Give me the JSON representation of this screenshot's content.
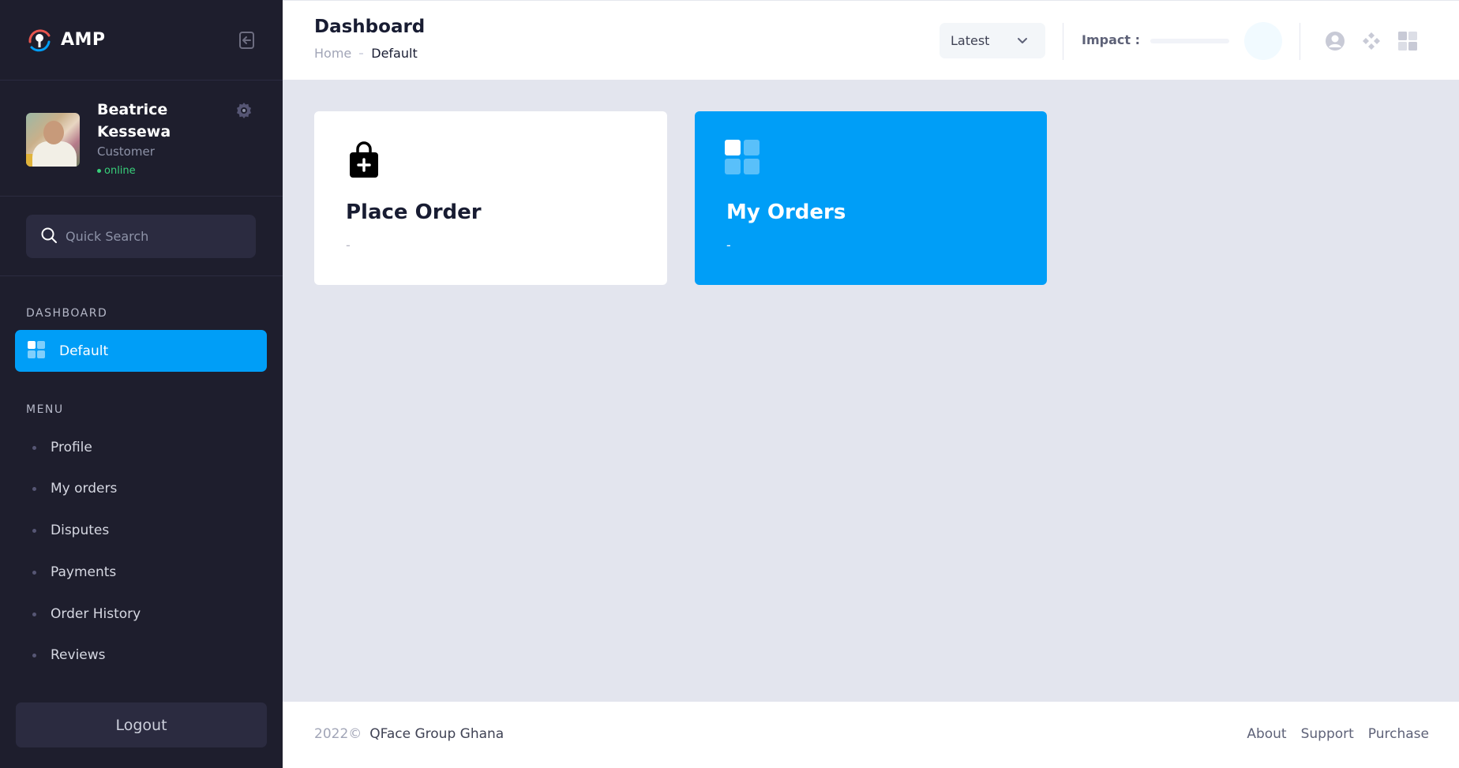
{
  "brand": {
    "name": "AMP"
  },
  "user": {
    "name": "Beatrice Kessewa",
    "role": "Customer",
    "status": "online"
  },
  "search": {
    "placeholder": "Quick Search"
  },
  "sidebar": {
    "dashboard_section": "DASHBOARD",
    "active_item": "Default",
    "menu_section": "MENU",
    "menu_items": [
      {
        "label": "Profile"
      },
      {
        "label": "My orders"
      },
      {
        "label": "Disputes"
      },
      {
        "label": "Payments"
      },
      {
        "label": "Order History"
      },
      {
        "label": "Reviews"
      }
    ],
    "logout_label": "Logout"
  },
  "header": {
    "title": "Dashboard",
    "breadcrumb": {
      "home": "Home",
      "current": "Default"
    },
    "filter_label": "Latest",
    "impact_label": "Impact :",
    "impact_progress": 0
  },
  "cards": [
    {
      "title": "Place Order",
      "subtitle": "-",
      "icon": "shopping-bag-plus-icon"
    },
    {
      "title": "My Orders",
      "subtitle": "-",
      "icon": "dashboard-grid-icon"
    }
  ],
  "footer": {
    "year": "2022©",
    "company": "QFace Group Ghana",
    "links": [
      "About",
      "Support",
      "Purchase"
    ]
  },
  "colors": {
    "sidebar_bg": "#1e1e2d",
    "accent": "#009ef7",
    "content_bg": "#e3e5ee",
    "online": "#38d07a"
  }
}
